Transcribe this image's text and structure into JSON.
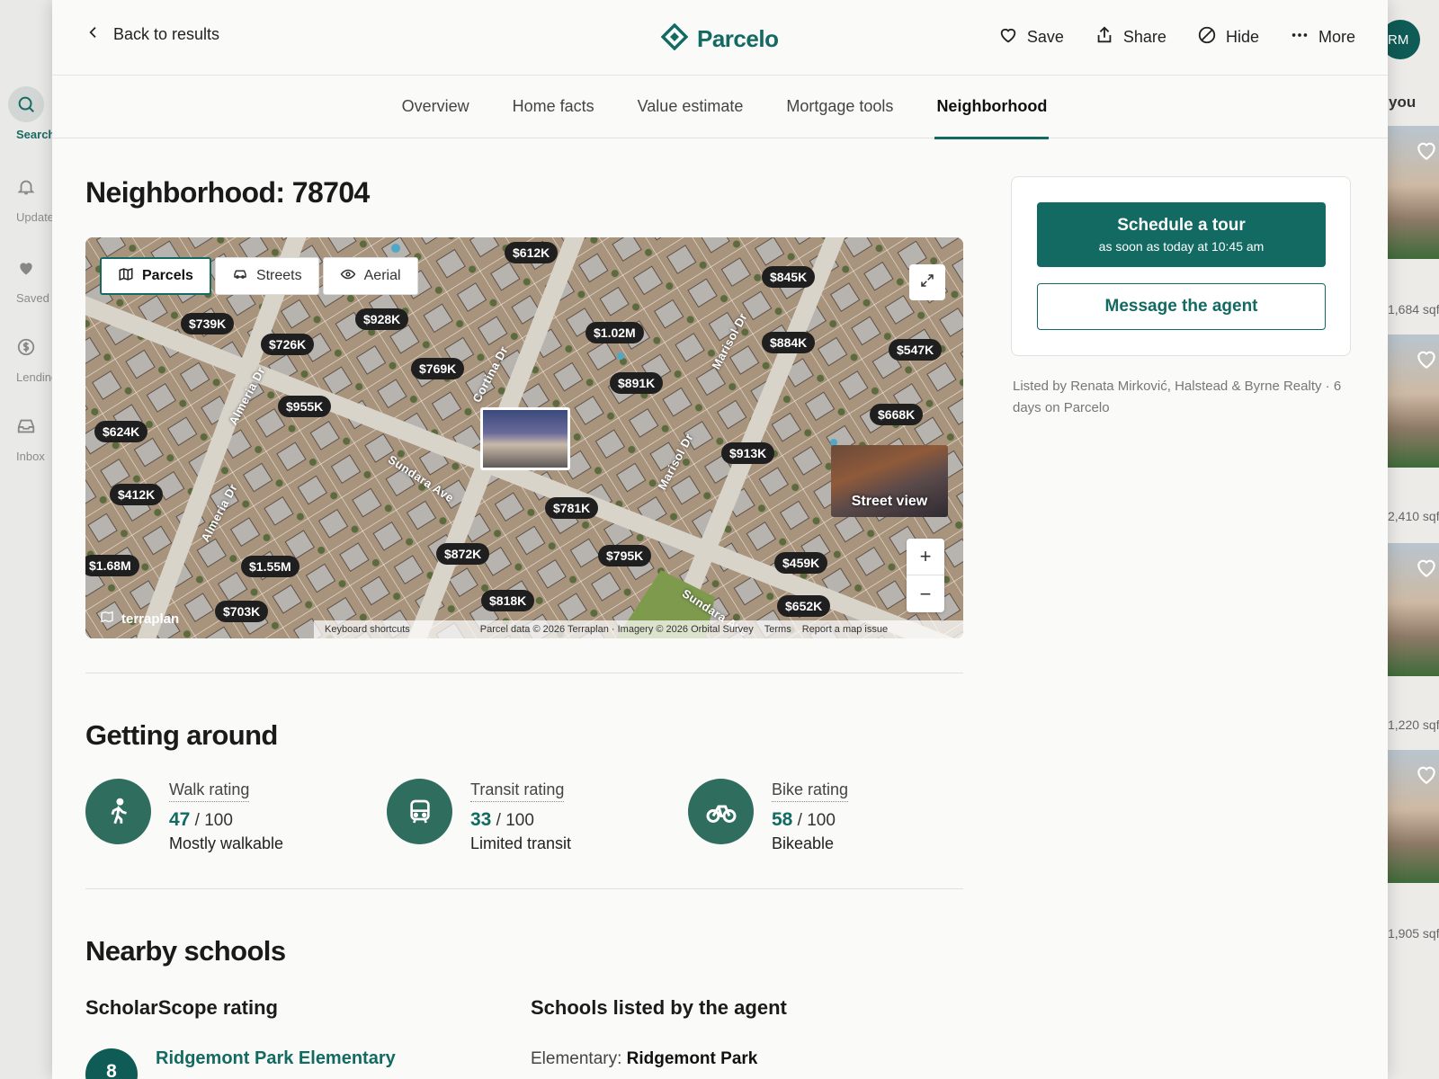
{
  "sidebar": {
    "items": [
      {
        "label": "Search",
        "icon": "search-icon",
        "active": true
      },
      {
        "label": "Updates",
        "icon": "bell-icon"
      },
      {
        "label": "Saved",
        "icon": "heart-icon"
      },
      {
        "label": "Lending",
        "icon": "dollar-icon"
      },
      {
        "label": "Inbox",
        "icon": "inbox-icon"
      }
    ]
  },
  "right_strip": {
    "avatar": "RM",
    "heading": "you",
    "sqft": [
      "1,684 sqf",
      "2,410 sqf",
      "1,220 sqf",
      "1,905 sqf"
    ]
  },
  "header": {
    "back_label": "Back to results",
    "brand": "Parcelo",
    "brand_color": "#126a62",
    "actions": {
      "save": "Save",
      "share": "Share",
      "hide": "Hide",
      "more": "More"
    }
  },
  "tabs": [
    "Overview",
    "Home facts",
    "Value estimate",
    "Mortgage tools",
    "Neighborhood"
  ],
  "active_tab": "Neighborhood",
  "neighborhood": {
    "title": "Neighborhood: 78704"
  },
  "map": {
    "modes": [
      "Parcels",
      "Streets",
      "Aerial"
    ],
    "active_mode": "Parcels",
    "prices": [
      "$612K",
      "$845K",
      "$739K",
      "$928K",
      "$726K",
      "$1.02M",
      "$884K",
      "$547K",
      "$769K",
      "$891K",
      "$955K",
      "$668K",
      "$624K",
      "$913K",
      "$412K",
      "$781K",
      "$872K",
      "$795K",
      "$459K",
      "$1.68M",
      "$1.55M",
      "$818K",
      "$703K",
      "$652K"
    ],
    "streets": [
      "Almeria Dr",
      "Cortina Dr",
      "Marisol Dr",
      "Sundara Ave"
    ],
    "street_view_label": "Street view",
    "brand": "terraplan",
    "attribution": {
      "keyboard": "Keyboard shortcuts",
      "data": "Parcel data © 2026 Terraplan · Imagery © 2026 Orbital Survey",
      "terms": "Terms",
      "report": "Report a map issue"
    }
  },
  "getting_around": {
    "title": "Getting around",
    "ratings": [
      {
        "label": "Walk rating",
        "score": "47",
        "max": "/ 100",
        "desc": "Mostly walkable",
        "icon": "walk-icon"
      },
      {
        "label": "Transit rating",
        "score": "33",
        "max": "/ 100",
        "desc": "Limited transit",
        "icon": "bus-icon"
      },
      {
        "label": "Bike rating",
        "score": "58",
        "max": "/ 100",
        "desc": "Bikeable",
        "icon": "bike-icon"
      }
    ]
  },
  "schools": {
    "title": "Nearby schools",
    "rating_heading": "ScholarScope rating",
    "listed_heading": "Schools listed by the agent",
    "first_school": {
      "rating": "8",
      "name": "Ridgemont Park Elementary"
    },
    "listed_elementary": {
      "label": "Elementary:",
      "name": "Ridgemont Park"
    }
  },
  "cta": {
    "tour_title": "Schedule a tour",
    "tour_subtitle": "as soon as today at 10:45 am",
    "message_label": "Message the agent"
  },
  "listing": {
    "listed_by": "Listed by Renata Mirković, Halstead & Byrne Realty · 6 days on Parcelo"
  }
}
